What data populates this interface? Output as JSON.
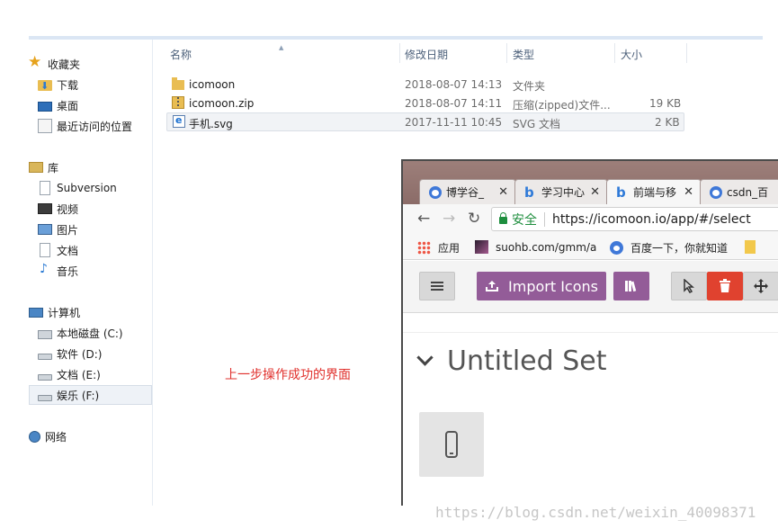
{
  "nav": {
    "favorites": "收藏夹",
    "downloads": "下载",
    "desktop": "桌面",
    "recent": "最近访问的位置",
    "libraries": "库",
    "subversion": "Subversion",
    "videos": "视频",
    "pictures": "图片",
    "documents": "文档",
    "music": "音乐",
    "computer": "计算机",
    "drive_c": "本地磁盘 (C:)",
    "drive_d": "软件 (D:)",
    "drive_e": "文档 (E:)",
    "drive_f": "娱乐 (F:)",
    "network": "网络"
  },
  "columns": {
    "name": "名称",
    "date": "修改日期",
    "type": "类型",
    "size": "大小"
  },
  "files": [
    {
      "name": "icomoon",
      "date": "2018-08-07 14:13",
      "type": "文件夹",
      "size": ""
    },
    {
      "name": "icomoon.zip",
      "date": "2018-08-07 14:11",
      "type": "压缩(zipped)文件...",
      "size": "19 KB"
    },
    {
      "name": "手机.svg",
      "date": "2017-11-11 10:45",
      "type": "SVG 文档",
      "size": "2 KB"
    }
  ],
  "caption": "上一步操作成功的界面",
  "browser": {
    "tabs": [
      {
        "label": "博学谷_",
        "close": "✕"
      },
      {
        "label": "学习中心",
        "close": "✕"
      },
      {
        "label": "前端与移",
        "close": "✕"
      },
      {
        "label": "csdn_百",
        "close": ""
      }
    ],
    "secure_label": "安全",
    "url": "https://icomoon.io/app/#/select",
    "bookmarks": [
      "应用",
      "suohb.com/gmm/a",
      "百度一下，你就知道"
    ],
    "import_label": "Import Icons",
    "set_title": "Untitled Set"
  },
  "watermark": "https://blog.csdn.net/weixin_40098371"
}
